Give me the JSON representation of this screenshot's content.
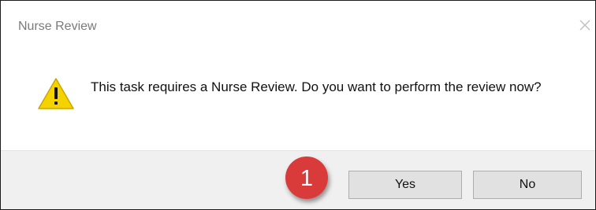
{
  "dialog": {
    "title": "Nurse Review",
    "close_icon": "close-icon",
    "warning_icon": "warning-icon",
    "message": "This task requires a Nurse Review.  Do you want to perform the review now?"
  },
  "buttons": {
    "yes_label": "Yes",
    "no_label": "No"
  },
  "annotation": {
    "step_number": "1",
    "badge_color": "#d93a3a"
  },
  "colors": {
    "warning_fill": "#f5d300",
    "footer_bg": "#f0f0f0",
    "button_bg": "#e1e1e1"
  }
}
